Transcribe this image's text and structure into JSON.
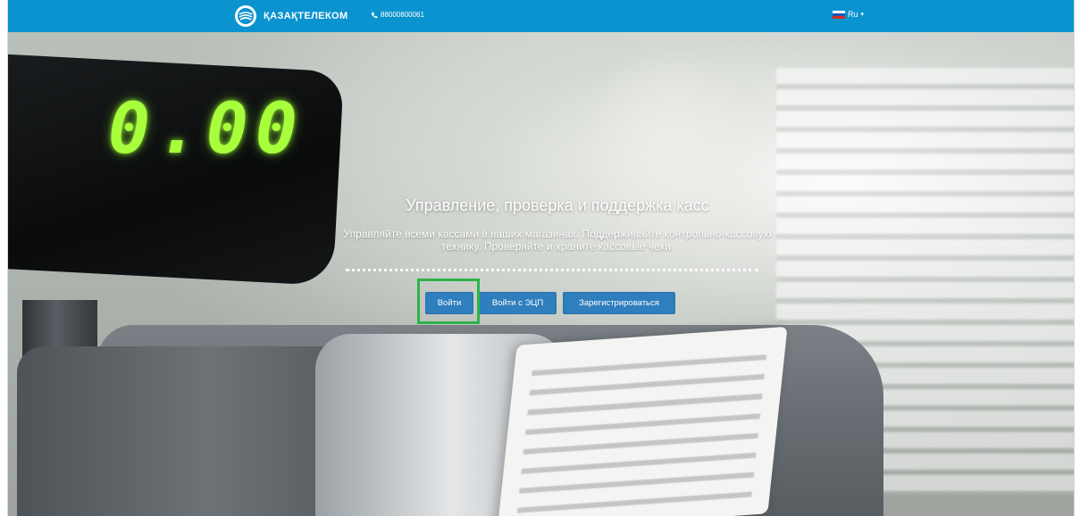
{
  "header": {
    "brand_name": "ҚАЗАҚТЕЛЕКОМ",
    "phone": "88000800061",
    "language": "Ru",
    "colors": {
      "bar": "#0a93cf"
    }
  },
  "hero": {
    "headline": "Управление, проверка и поддержка касс",
    "subtext": "Управляйте всеми кассами в ваших магазинах. Поддерживайте контрольно-кассовую технику. Проверяйте и храните кассовые чеки.",
    "display_value": "0.00",
    "buttons": {
      "login": "Войти",
      "login_ecp": "Войти с ЭЦП",
      "register": "Зарегистрироваться"
    },
    "colors": {
      "button": "#2f7ebd",
      "highlight": "#2db34a"
    }
  }
}
